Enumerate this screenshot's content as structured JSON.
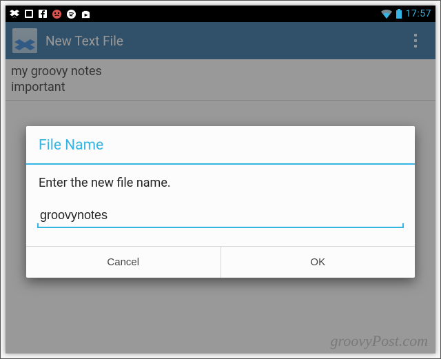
{
  "status_bar": {
    "clock": "17:57"
  },
  "action_bar": {
    "title": "New Text File"
  },
  "editor": {
    "line1": "my groovy notes",
    "line2": "important"
  },
  "dialog": {
    "title": "File Name",
    "message": "Enter the new file name.",
    "input_value": "groovynotes",
    "cancel_label": "Cancel",
    "ok_label": "OK"
  },
  "watermark": "groovyPost.com"
}
